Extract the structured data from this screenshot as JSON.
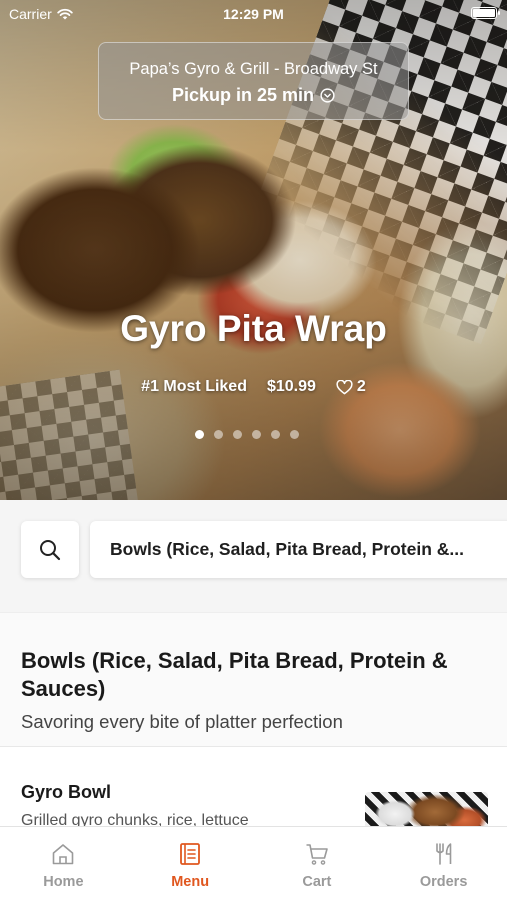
{
  "status_bar": {
    "carrier": "Carrier",
    "time": "12:29 PM",
    "battery_level": 1.0
  },
  "pickup": {
    "store_name": "Papa’s Gyro & Grill - Broadway St",
    "eta": "Pickup in 25 min",
    "icon": "chevron-down-circle-icon"
  },
  "hero": {
    "dish_title": "Gyro Pita Wrap",
    "rank": "#1 Most Liked",
    "price": "$10.99",
    "likes": "2",
    "carousel_count": 6,
    "carousel_active_index": 0
  },
  "search": {
    "icon": "search-icon",
    "category_label": "Bowls (Rice, Salad, Pita Bread, Protein &..."
  },
  "section": {
    "title": "Bowls (Rice, Salad, Pita Bread, Protein & Sauces)",
    "subtitle": "Savoring every bite of platter perfection"
  },
  "items": [
    {
      "name": "Gyro Bowl",
      "description": "Grilled gyro chunks, rice, lettuce"
    }
  ],
  "tabs": [
    {
      "label": "Home",
      "icon": "home-icon",
      "active": false
    },
    {
      "label": "Menu",
      "icon": "menu-icon",
      "active": true
    },
    {
      "label": "Cart",
      "icon": "cart-icon",
      "active": false
    },
    {
      "label": "Orders",
      "icon": "fork-knife-icon",
      "active": false
    }
  ],
  "colors": {
    "accent": "#e0571f",
    "tab_inactive": "#9a9a9a"
  }
}
